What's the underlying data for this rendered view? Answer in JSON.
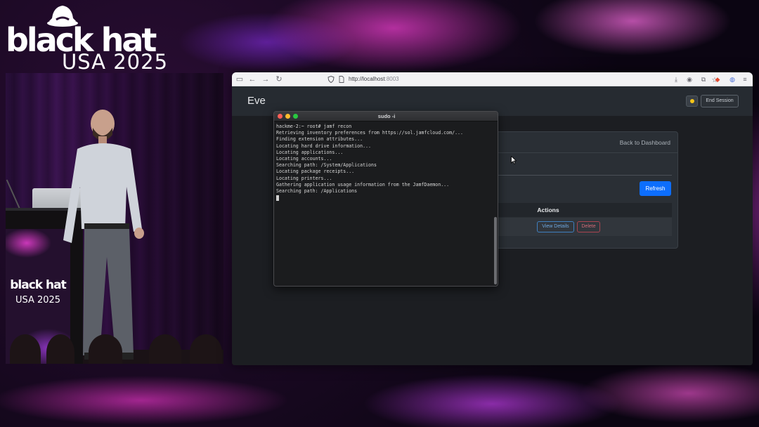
{
  "event_logo": {
    "name": "black hat",
    "edition": "USA 2025"
  },
  "podium_logo": {
    "name": "black hat",
    "edition": "USA 2025"
  },
  "browser": {
    "url_host": "http://localhost",
    "url_port": ":8003",
    "icons": [
      "sidebar-icon",
      "back-icon",
      "forward-icon",
      "reload-icon",
      "shield-icon",
      "page-icon",
      "bookmark-star-icon",
      "download-icon",
      "account-icon",
      "extensions-icon",
      "brave-icon",
      "globe-icon",
      "menu-icon"
    ]
  },
  "app": {
    "title": "Eve",
    "end_session_label": "End Session",
    "back_link_label": "Back to Dashboard",
    "refresh_label": "Refresh",
    "table": {
      "columns": [
        "Actions"
      ],
      "rows": [
        {
          "view_label": "View Details",
          "delete_label": "Delete"
        }
      ]
    }
  },
  "terminal": {
    "title": "sudo -i",
    "lines": [
      "hackme-2:~ root# jamf recon",
      "Retrieving inventory preferences from https://sol.jamfcloud.com/...",
      "Finding extension attributes...",
      "Locating hard drive information...",
      "Locating applications...",
      "Locating accounts...",
      "Searching path: /System/Applications",
      "Locating package receipts...",
      "Locating printers...",
      "Gathering application usage information from the JamfDaemon...",
      "Searching path: /Applications"
    ]
  },
  "colors": {
    "accent_primary": "#0d6efd",
    "danger": "#d26a76",
    "app_background": "#1c1e22",
    "terminal_background": "#1b1c1e"
  }
}
